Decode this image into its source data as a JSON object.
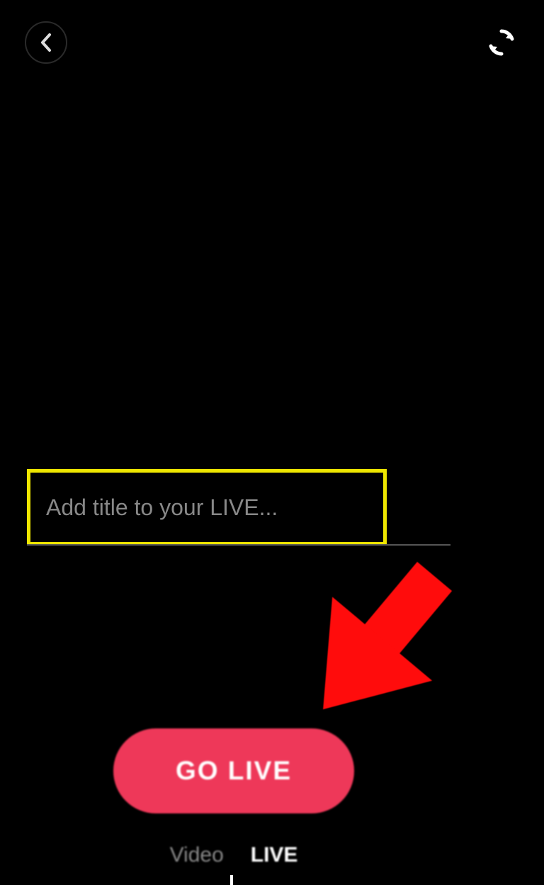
{
  "header": {
    "back": "back",
    "flip": "flip-camera"
  },
  "title_input": {
    "placeholder": "Add title to your LIVE...",
    "value": ""
  },
  "go_live": {
    "label": "GO LIVE"
  },
  "tabs": {
    "video": "Video",
    "live": "LIVE"
  },
  "annotation": {
    "highlight_color": "#eee600",
    "arrow_color": "#ff0000"
  }
}
